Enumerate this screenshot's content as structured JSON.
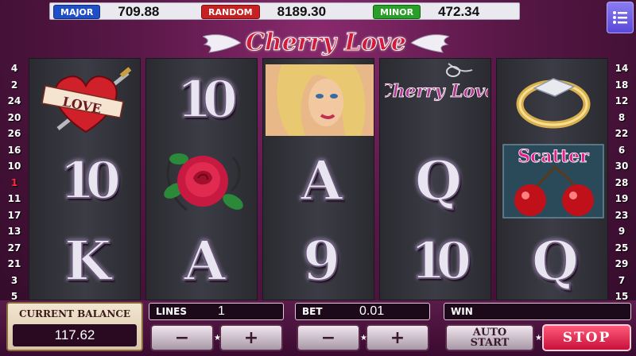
{
  "jackpots": [
    {
      "label": "MAJOR",
      "value": "709.88",
      "color": "#1f4fc8"
    },
    {
      "label": "RANDOM",
      "value": "8189.30",
      "color": "#c82020"
    },
    {
      "label": "MINOR",
      "value": "472.34",
      "color": "#28a028"
    }
  ],
  "menu": {
    "icon": "list-icon"
  },
  "logo": {
    "text": "Cherry Love"
  },
  "left_numbers": [
    "4",
    "2",
    "24",
    "20",
    "26",
    "16",
    "10",
    "1",
    "11",
    "17",
    "13",
    "27",
    "21",
    "3",
    "5"
  ],
  "right_numbers": [
    "14",
    "18",
    "12",
    "8",
    "22",
    "6",
    "30",
    "28",
    "19",
    "23",
    "9",
    "25",
    "29",
    "7",
    "15"
  ],
  "highlight_number": "1",
  "reels": [
    [
      "love-heart-dagger",
      "10",
      "K"
    ],
    [
      "10",
      "rose",
      "A"
    ],
    [
      "blonde-woman",
      "A",
      "9"
    ],
    [
      "cherry-love-pendant",
      "Q",
      "10"
    ],
    [
      "gold-ring",
      "scatter-cherries",
      "Q"
    ]
  ],
  "symbol_texts": {
    "love": "LOVE",
    "pendant": "Cherry Love",
    "scatter": "Scatter"
  },
  "panel": {
    "balance_label": "CURRENT BALANCE",
    "balance_value": "117.62",
    "lines_label": "LINES",
    "lines_value": "1",
    "bet_label": "BET",
    "bet_value": "0.01",
    "win_label": "WIN",
    "win_value": "",
    "minus": "−",
    "plus": "+",
    "auto_start": "AUTO START",
    "stop": "STOP"
  }
}
